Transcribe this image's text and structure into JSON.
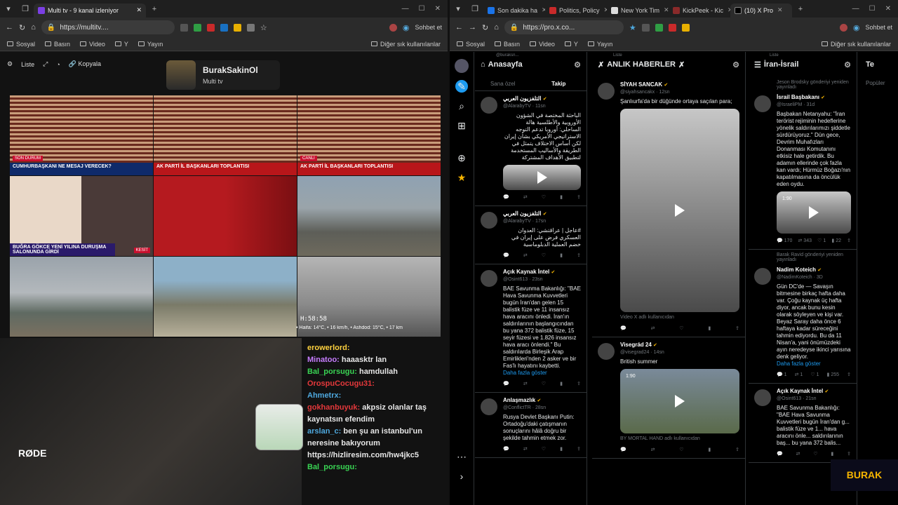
{
  "left_window": {
    "tab_title": "Multi tv - 9 kanal izleniyor",
    "url": "https://multitv....",
    "chat_button": "Sohbet et",
    "bookmarks": [
      "Sosyal",
      "Basın",
      "Video",
      "Y",
      "Yayın"
    ],
    "bookmarks_right": "Diğer sık kullanılanlar",
    "toolbar": {
      "list": "Liste",
      "copy": "Kopyala"
    },
    "channel": {
      "name": "BurakSakinOl",
      "sub": "Multi tv"
    },
    "tiles": [
      {
        "lower": "CUMHURBAŞKANI NE MESAJ VERECEK?",
        "tag": "SON DURUM"
      },
      {
        "lower": "AK PARTİ İL BAŞKANLARI TOPLANTISI",
        "tag": ""
      },
      {
        "lower": "AK PARTİ İL BAŞKANLARI TOPLANTISI",
        "tag": "CANLI"
      },
      {
        "lower": "BUĞRA GÖKCE YENİ YILINA DURUŞMA SALONUNDA GİRDİ",
        "tag": "KESİT"
      }
    ],
    "clock": "H:58:58",
    "ticker": "• Haifa: 14°C, • 16 km/h, • Ashdod: 15°C, • 17 km",
    "cam_brand": "RØDE",
    "chat": [
      {
        "user": "erowerlord:",
        "text": "",
        "color": "#ffd23f"
      },
      {
        "user": "Minatoo:",
        "text": "haaasktr lan",
        "color": "#c77dff"
      },
      {
        "user": "Bal_porsugu:",
        "text": "hamdullah",
        "color": "#39d353"
      },
      {
        "user": "OrospuCocugu31:",
        "text": "",
        "color": "#e5383b"
      },
      {
        "user": "Ahmetrx:",
        "text": "",
        "color": "#4ea8de"
      },
      {
        "user": "gokhanbuyuk:",
        "text": "akpsiz olanlar taş kaynatsın efendim",
        "color": "#e5383b"
      },
      {
        "user": "arslan_c:",
        "text": "ben şu an istanbul'un neresine bakıyorum https://hizliresim.com/hw4jkc5",
        "color": "#4ea8de"
      },
      {
        "user": "Bal_porsugu:",
        "text": "",
        "color": "#39d353"
      }
    ]
  },
  "right_window": {
    "tabs": [
      "Son dakika ha",
      "Politics, Policy",
      "New York Tim",
      "KickPeek - Kic",
      "(10) X Pro"
    ],
    "url": "https://pro.x.co...",
    "chat_button": "Sohbet et",
    "bookmarks": [
      "Sosyal",
      "Basın",
      "Video",
      "Y",
      "Yayın"
    ],
    "bookmarks_right": "Diğer sık kullanılanlar",
    "col1": {
      "pre": "@buraksn...",
      "title": "Anasayfa",
      "tabs": [
        "Sana özel",
        "Takip"
      ],
      "tweets": [
        {
          "name": "التلفزيون العربي",
          "handle": "@AlarabyTV · 11sn",
          "text": "الباحثة المختصة في الشؤون الأوروبية والأطلسية هالة الساحلي: أوروبا تدعم التوجه الاستراتيجي الأمريكي بشأن إيران لكن أساس الاختلاف يتمثل في الطريقة والأساليب المستخدمة لتطبيق الأهداف المشتركة",
          "rtl": true
        },
        {
          "name": "التلفزيون العربي",
          "handle": "@AlarabyTV · 17sn",
          "text": "#عاجل | عراقتشي: العدوان العسكري فرض على إيران في خضم العملية الدبلوماسية",
          "rtl": true
        },
        {
          "name": "Açık Kaynak İntel",
          "handle": "@Osint613 · 23sn",
          "text": "BAE Savunma Bakanlığı: \"BAE Hava Savunma Kuvvetleri bugün İran'dan gelen 15 balistik füze ve 11 insansız hava aracını önledi. İran'ın saldırılarının başlangıcından bu yana 372 balistik füze, 15 seyir füzesi ve 1.826 insansız hava aracı önlendi.\" Bu saldırılarda Birleşik Arap Emirlikleri'nden 2 asker ve bir Fas'lı hayatını kaybetti.",
          "more": "Daha fazla göster",
          "rtl": false
        },
        {
          "name": "Anlaşmazlık",
          "handle": "@ConflictTR · 28sn",
          "text": "Rusya Devlet Başkanı Putin: Ortadoğu'daki çatışmanın sonuçlarını hâlâ doğru bir şekilde tahmin etmek zor.",
          "rtl": false
        }
      ]
    },
    "col2": {
      "pre": "Liste",
      "title": "ANLIK HABERLER",
      "tweets": [
        {
          "name": "SİYAH SANCAK",
          "handle": "@siyahsancakx · 12sn",
          "text": "Şanlıurfa'da bir düğünde ortaya saçılan para;",
          "foot": "Video X adlı kullanıcıdan"
        },
        {
          "name": "Visegrád 24",
          "handle": "@visegrad24 · 14sn",
          "text": "British summer",
          "foot": "BY MORTAL HAND adlı kullanıcıdan",
          "time": "1:90"
        }
      ]
    },
    "col3": {
      "pre": "Liste",
      "title": "İran-İsrail",
      "tweets": [
        {
          "ctx": "Jeson Brodsky gönderiyi yeniden yayınladı",
          "name": "İsrail Başbakanı",
          "handle": "@IsraeliPM · 31d",
          "text": "Başbakan Netanyahu: \"İran terörist rejiminin hedeflerine yönelik saldırılarımızı şiddetle sürdürüyoruz.\" Dün gece, Devrim Muhafızları Donanması Komutanını etkisiz hale getirdik. Bu adamın ellerinde çok fazla kan vardı; Hürmüz Boğazı'nın kapatılmasına da öncülük eden oydu.",
          "time": "1:90",
          "stats": [
            "170",
            "343",
            "1",
            "22"
          ]
        },
        {
          "ctx": "Barak Ravid gönderiyi yeniden yayınladı",
          "name": "Nadim Koteich",
          "handle": "@NadimKoteich · 3D",
          "text": "Gün DC'de — Savaşın bitmesine birkaç hafta daha var. Çoğu kaynak üç hafta diyor, ancak bunu kesin olarak söyleyen ve kişi var. Beyaz Saray daha önce 6 haftaya kadar süreceğini tahmin ediyordu. Bu da 11 Nisan'a, yani önümüzdeki ayın neredeyse ikinci yarısına denk geliyor.",
          "more": "Daha fazla göster",
          "stats": [
            "1",
            "1",
            "1",
            "255"
          ]
        },
        {
          "ctx": "",
          "name": "Açık Kaynak İntel",
          "handle": "@Osint613 · 21sn",
          "text": "BAE Savunma Bakanlığı: \"BAE Hava Savunma Kuvvetleri bugün İran'dan g... balistik füze ve 1... hava aracını önle... saldırılarının baş... bu yana 372 balis...",
          "stats": []
        }
      ]
    },
    "col4_title": "Te",
    "col4_sub": "Popüler",
    "overlay": "BURAK"
  }
}
